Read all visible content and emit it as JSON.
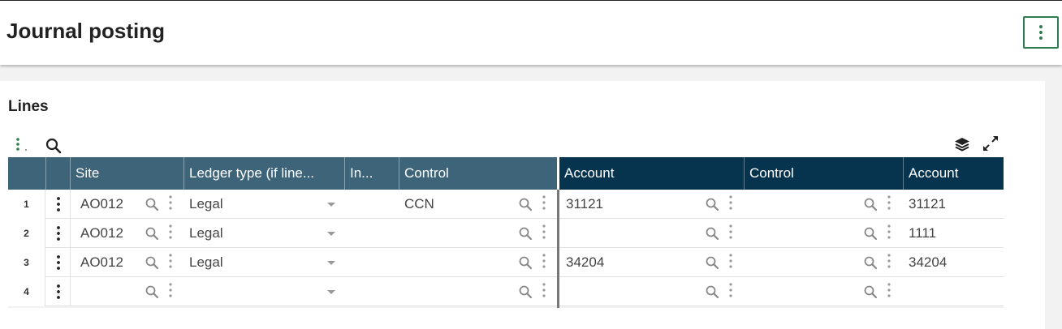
{
  "header": {
    "title": "Journal posting"
  },
  "section": {
    "title": "Lines"
  },
  "grid": {
    "columns": [
      "Site",
      "Ledger type (if line...",
      "In...",
      "Control",
      "Account",
      "Control",
      "Account"
    ],
    "rows": [
      {
        "num": "1",
        "site": "AO012",
        "ledger": "Legal",
        "control1": "CCN",
        "account1": "31121",
        "account2": "31121"
      },
      {
        "num": "2",
        "site": "AO012",
        "ledger": "Legal",
        "control1": "",
        "account1": "",
        "account2": "1111"
      },
      {
        "num": "3",
        "site": "AO012",
        "ledger": "Legal",
        "control1": "",
        "account1": "34204",
        "account2": "34204"
      },
      {
        "num": "4",
        "site": "",
        "ledger": "",
        "control1": "",
        "account1": "",
        "account2": ""
      }
    ]
  },
  "icons": [
    "more-vert-icon",
    "search-icon",
    "layers-icon",
    "expand-icon",
    "chevron-down-icon"
  ],
  "colors": {
    "header_left": "#3e6479",
    "header_right": "#06344f",
    "accent": "#2e7d4f"
  }
}
